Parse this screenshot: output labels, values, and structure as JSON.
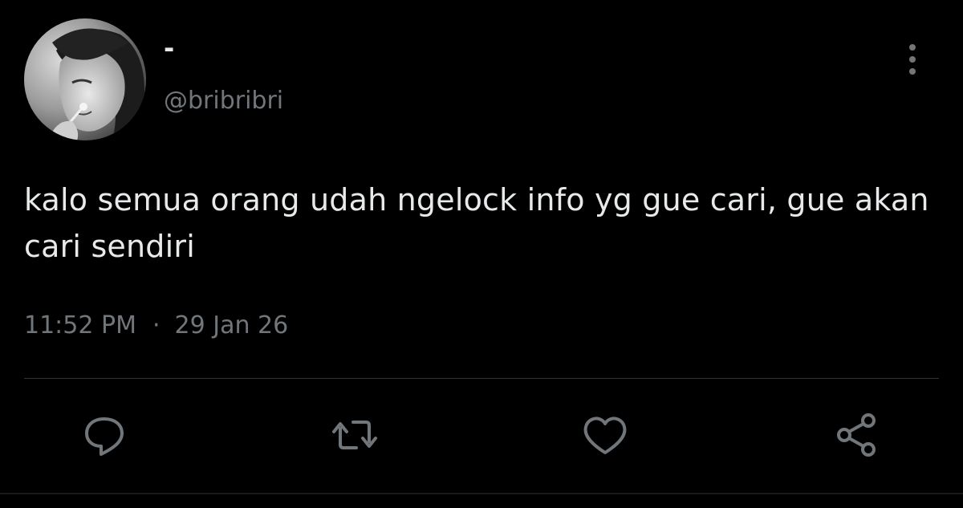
{
  "tweet": {
    "display_name": "-",
    "handle": "@bribribri",
    "text": "kalo semua orang udah ngelock info yg gue cari, gue akan cari sendiri",
    "time": "11:52 PM",
    "separator": "·",
    "date": "29 Jan 26"
  },
  "icons": {
    "avatar": "avatar-photo",
    "more": "more-vertical-icon",
    "reply": "reply-icon",
    "retweet": "retweet-icon",
    "like": "heart-icon",
    "share": "share-icon"
  },
  "colors": {
    "background": "#000000",
    "primary_text": "#e7e9ea",
    "secondary_text": "#71767b",
    "divider": "#2f3336",
    "icon": "#71767b"
  }
}
